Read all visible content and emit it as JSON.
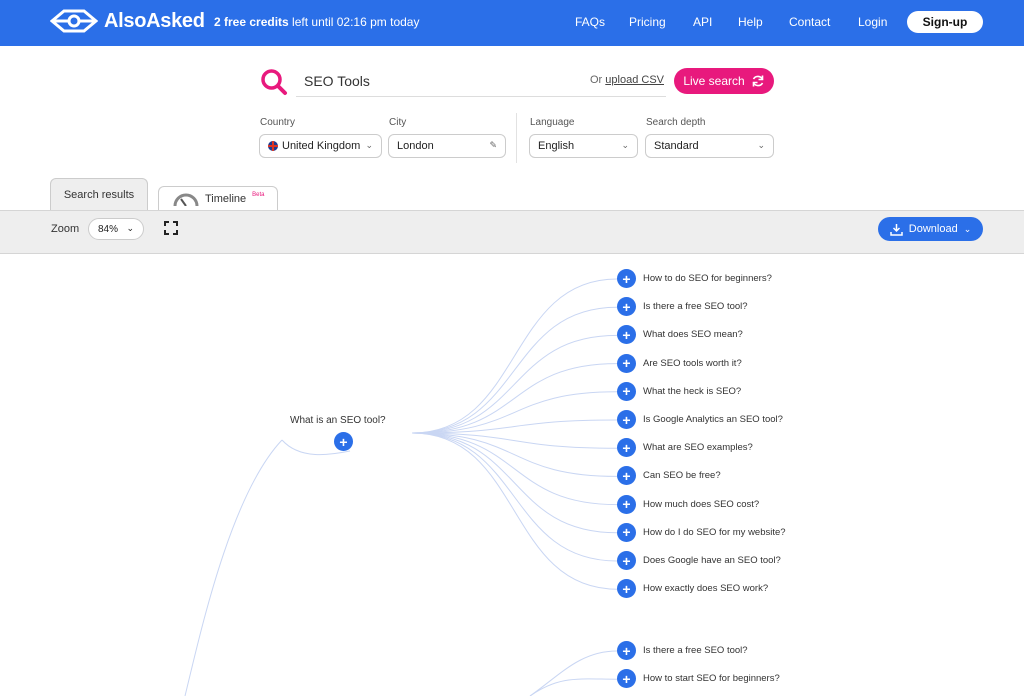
{
  "header": {
    "logo_text": "AlsoAsked",
    "credits_bold": "2 free credits",
    "credits_rest": " left until 02:16 pm today",
    "nav": [
      "FAQs",
      "Pricing",
      "API",
      "Help",
      "Contact",
      "Login"
    ],
    "signup_label": "Sign-up"
  },
  "search": {
    "query": "SEO Tools",
    "upload_prefix": "Or ",
    "upload_link": "upload CSV",
    "live_search_label": "Live search"
  },
  "filters": {
    "country_label": "Country",
    "country_value": "United Kingdom",
    "city_label": "City",
    "city_value": "London",
    "language_label": "Language",
    "language_value": "English",
    "depth_label": "Search depth",
    "depth_value": "Standard"
  },
  "tabs": {
    "results_label": "Search results",
    "timeline_label": "Timeline",
    "timeline_badge": "Beta"
  },
  "toolbar": {
    "zoom_label": "Zoom",
    "zoom_value": "84%",
    "download_label": "Download"
  },
  "mindmap": {
    "root_question": "What is an SEO tool?",
    "children": [
      "How to do SEO for beginners?",
      "Is there a free SEO tool?",
      "What does SEO mean?",
      "Are SEO tools worth it?",
      "What the heck is SEO?",
      "Is Google Analytics an SEO tool?",
      "What are SEO examples?",
      "Can SEO be free?",
      "How much does SEO cost?",
      "How do I do SEO for my website?",
      "Does Google have an SEO tool?",
      "How exactly does SEO work?"
    ],
    "second_group": [
      "Is there a free SEO tool?",
      "How to start SEO for beginners?"
    ]
  },
  "colors": {
    "brand_blue": "#2b6fe8",
    "accent_pink": "#e8197d",
    "link_line": "#c9d6f3"
  }
}
